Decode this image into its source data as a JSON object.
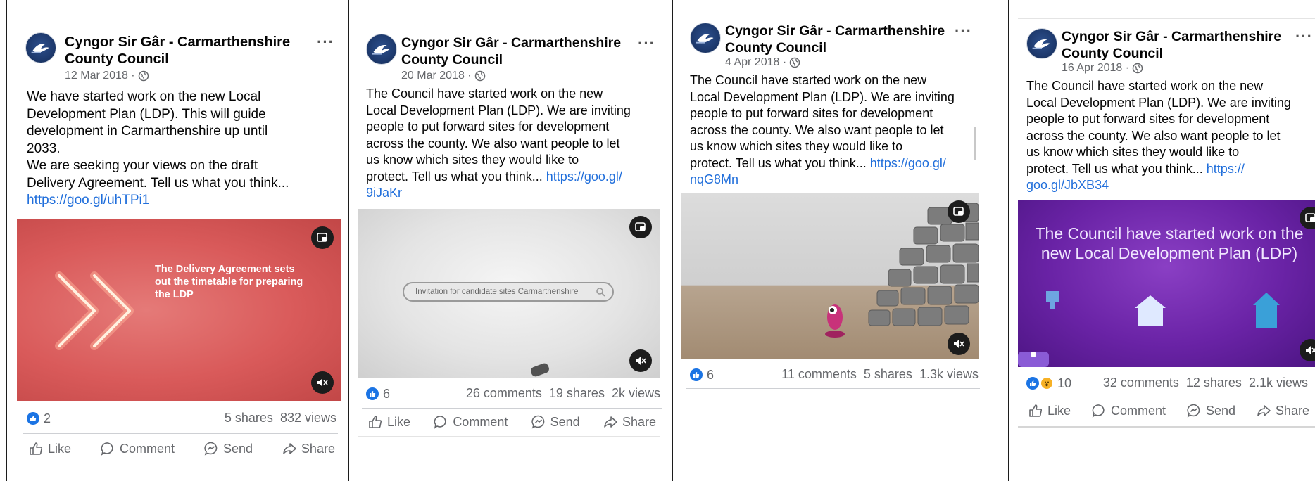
{
  "page": {
    "name": "Cyngor Sir Gâr - Carmarthenshire County Council",
    "name_line1": "Cyngor Sir Gâr - Carmarthenshire",
    "name_line2": "County Council"
  },
  "actions": {
    "like": "Like",
    "comment": "Comment",
    "send": "Send",
    "share": "Share"
  },
  "posts": [
    {
      "date": "12 Mar 2018 ·",
      "text_lines": [
        "We have started work on the new Local",
        "Development Plan (LDP). This will guide",
        "development in Carmarthenshire up until",
        "2033.",
        "We are seeking your views on the draft",
        "Delivery Agreement. Tell us what you think..."
      ],
      "link": "https://goo.gl/uhTPi1",
      "video_overlay_lines": [
        "The Delivery Agreement sets",
        "out the timetable for preparing",
        "the LDP"
      ],
      "reactions": "2",
      "comments": "",
      "shares": "5 shares",
      "views": "832 views"
    },
    {
      "date": "20 Mar 2018 ·",
      "text_lines": [
        "The Council have started work on the new",
        "Local Development Plan (LDP). We are inviting",
        "people to put forward sites for development",
        "across the county. We also want people to let",
        "us know which sites they would like to"
      ],
      "last_line": "protect. Tell us what you think... ",
      "link_part1": "https://goo.gl/",
      "link_part2": "9iJaKr",
      "search_text": "Invitation for candidate sites Carmarthenshire",
      "reactions": "6",
      "comments": "26 comments",
      "shares": "19 shares",
      "views": "2k views"
    },
    {
      "date": "4 Apr 2018 ·",
      "text_lines": [
        "The Council have started work on the new",
        "Local Development Plan (LDP). We are inviting",
        "people to put forward sites for development",
        "across the county. We also want people to let",
        "us know which sites they would like to"
      ],
      "last_line": "protect. Tell us what you think... ",
      "link_part1": "https://goo.gl/",
      "link_part2": "nqG8Mn",
      "reactions": "6",
      "comments": "11 comments",
      "shares": "5 shares",
      "views": "1.3k views"
    },
    {
      "date": "16 Apr 2018 ·",
      "text_lines": [
        "The Council have started work on the new",
        "Local Development Plan (LDP). We are inviting",
        "people to put forward sites for development",
        "across the county. We also want people to let",
        "us know which sites they would like to"
      ],
      "last_line": "protect. Tell us what you think...  ",
      "link_part1": "https://",
      "link_part2": "goo.gl/JbXB34",
      "video_overlay_lines": [
        "The Council have started work on the",
        "new Local Development Plan (LDP)"
      ],
      "reactions": "10",
      "comments": "32 comments",
      "shares": "12 shares",
      "views": "2.1k views"
    }
  ],
  "colors": {
    "link": "#216fdb",
    "like_blue": "#1b74e4",
    "meta_gray": "#65676b"
  }
}
